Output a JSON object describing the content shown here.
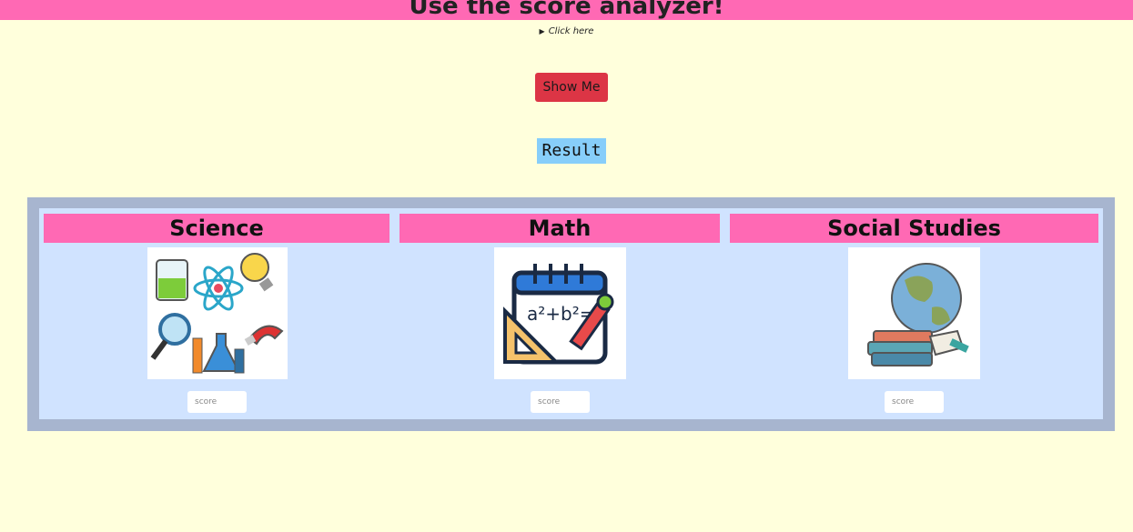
{
  "header": {
    "title": "Use the score analyzer!"
  },
  "details": {
    "summary": "Click here"
  },
  "actions": {
    "show_label": "Show Me"
  },
  "result": {
    "label": "Result"
  },
  "subjects": [
    {
      "title": "Science",
      "image": "science-clipart",
      "score_placeholder": "score"
    },
    {
      "title": "Math",
      "image": "math-clipart",
      "score_placeholder": "score"
    },
    {
      "title": "Social Studies",
      "image": "social-studies-clipart",
      "score_placeholder": "score"
    }
  ],
  "colors": {
    "background": "#ffffdc",
    "accent_pink": "#ff69b4",
    "button_red": "#dc3545",
    "result_blue": "#87cefa",
    "panel_border": "#a7b5cf",
    "panel_fill": "#d0e3ff"
  }
}
